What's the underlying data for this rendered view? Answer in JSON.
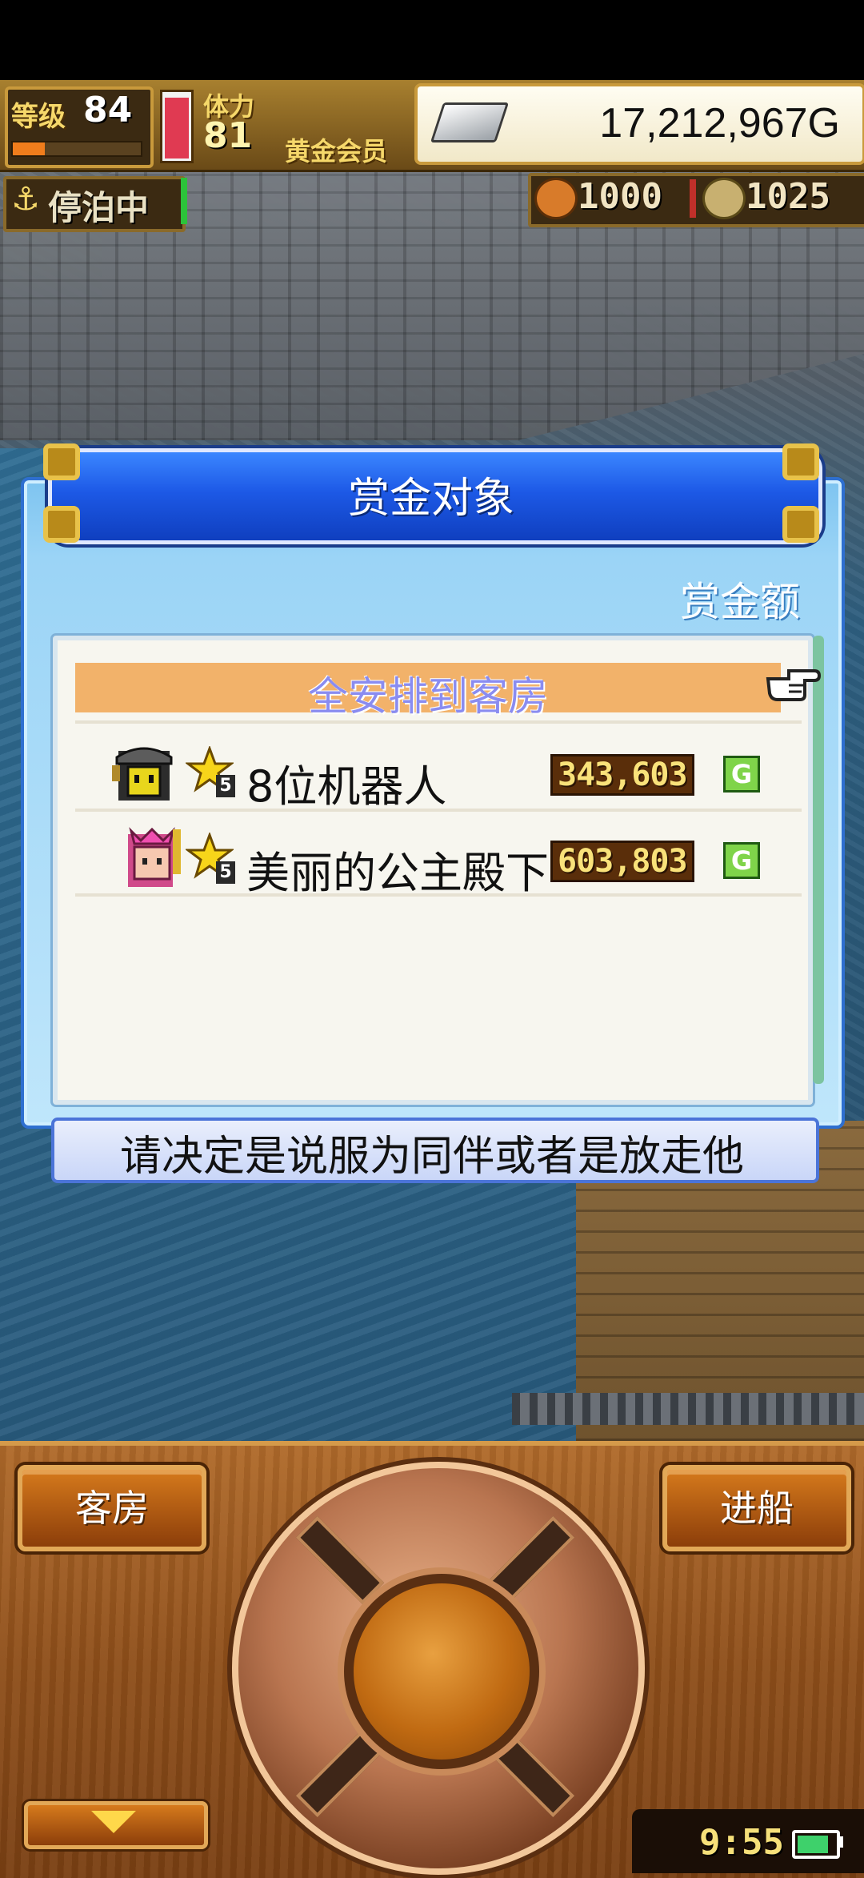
{
  "hud": {
    "level_label": "等级",
    "level": "84",
    "xp_fraction": 0.25,
    "stamina_label": "体力",
    "stamina": "81",
    "stamina_fraction": 0.95,
    "membership": "黄金会员",
    "gold": "17,212,967G",
    "dock_status": "停泊中",
    "resource_1": "1000",
    "resource_2": "1025"
  },
  "dialog": {
    "title": "赏金对象",
    "amount_header": "赏金额",
    "all_row_label": "全安排到客房",
    "rows": [
      {
        "name": "8位机器人",
        "star_level": "5",
        "bounty": "343,603",
        "unit": "G"
      },
      {
        "name": "美丽的公主殿下",
        "star_level": "5",
        "bounty": "603,803",
        "unit": "G"
      }
    ],
    "prompt": "请决定是说服为同伴或者是放走他"
  },
  "controls": {
    "left_button": "客房",
    "right_button": "进船"
  },
  "clock": "9:55",
  "colors": {
    "header_blue": "#1d59e6",
    "panel_blue": "#9bd4f6",
    "wood": "#8f4f1a",
    "highlight_orange": "#f2b26a"
  }
}
